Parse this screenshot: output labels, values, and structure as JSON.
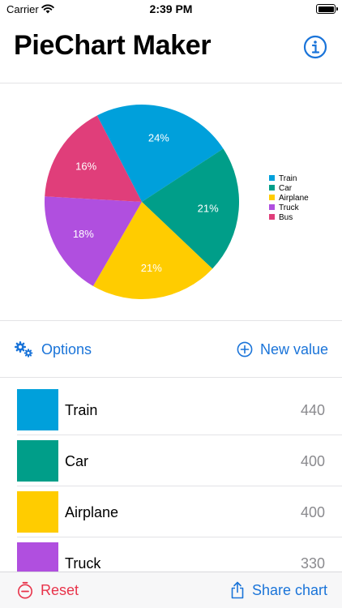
{
  "status_bar": {
    "carrier": "Carrier",
    "time": "2:39 PM"
  },
  "header": {
    "title": "PieChart Maker",
    "info_icon": "info-circle-icon"
  },
  "chart_data": {
    "type": "pie",
    "title": "",
    "categories": [
      "Train",
      "Car",
      "Airplane",
      "Truck",
      "Bus"
    ],
    "values": [
      440,
      400,
      400,
      330,
      310
    ],
    "percent_labels": [
      "24%",
      "21%",
      "21%",
      "18%",
      "16%"
    ],
    "colors": [
      "#00a0db",
      "#009e89",
      "#ffcc00",
      "#b04fdf",
      "#e03e7a"
    ],
    "legend": [
      "Train",
      "Car",
      "Airplane",
      "Truck",
      "Bus"
    ],
    "legend_position": "right"
  },
  "controls": {
    "options_label": "Options",
    "options_icon": "gears-icon",
    "new_value_label": "New value",
    "new_value_icon": "plus-circle-icon"
  },
  "list": {
    "rows": [
      {
        "label": "Train",
        "value": "440",
        "color": "#00a0db"
      },
      {
        "label": "Car",
        "value": "400",
        "color": "#009e89"
      },
      {
        "label": "Airplane",
        "value": "400",
        "color": "#ffcc00"
      },
      {
        "label": "Truck",
        "value": "330",
        "color": "#b04fdf"
      }
    ]
  },
  "toolbar": {
    "reset_label": "Reset",
    "reset_icon": "minus-timer-icon",
    "share_label": "Share chart",
    "share_icon": "share-icon"
  },
  "accent_colors": {
    "link": "#1a74d9",
    "destructive": "#e8334a"
  }
}
